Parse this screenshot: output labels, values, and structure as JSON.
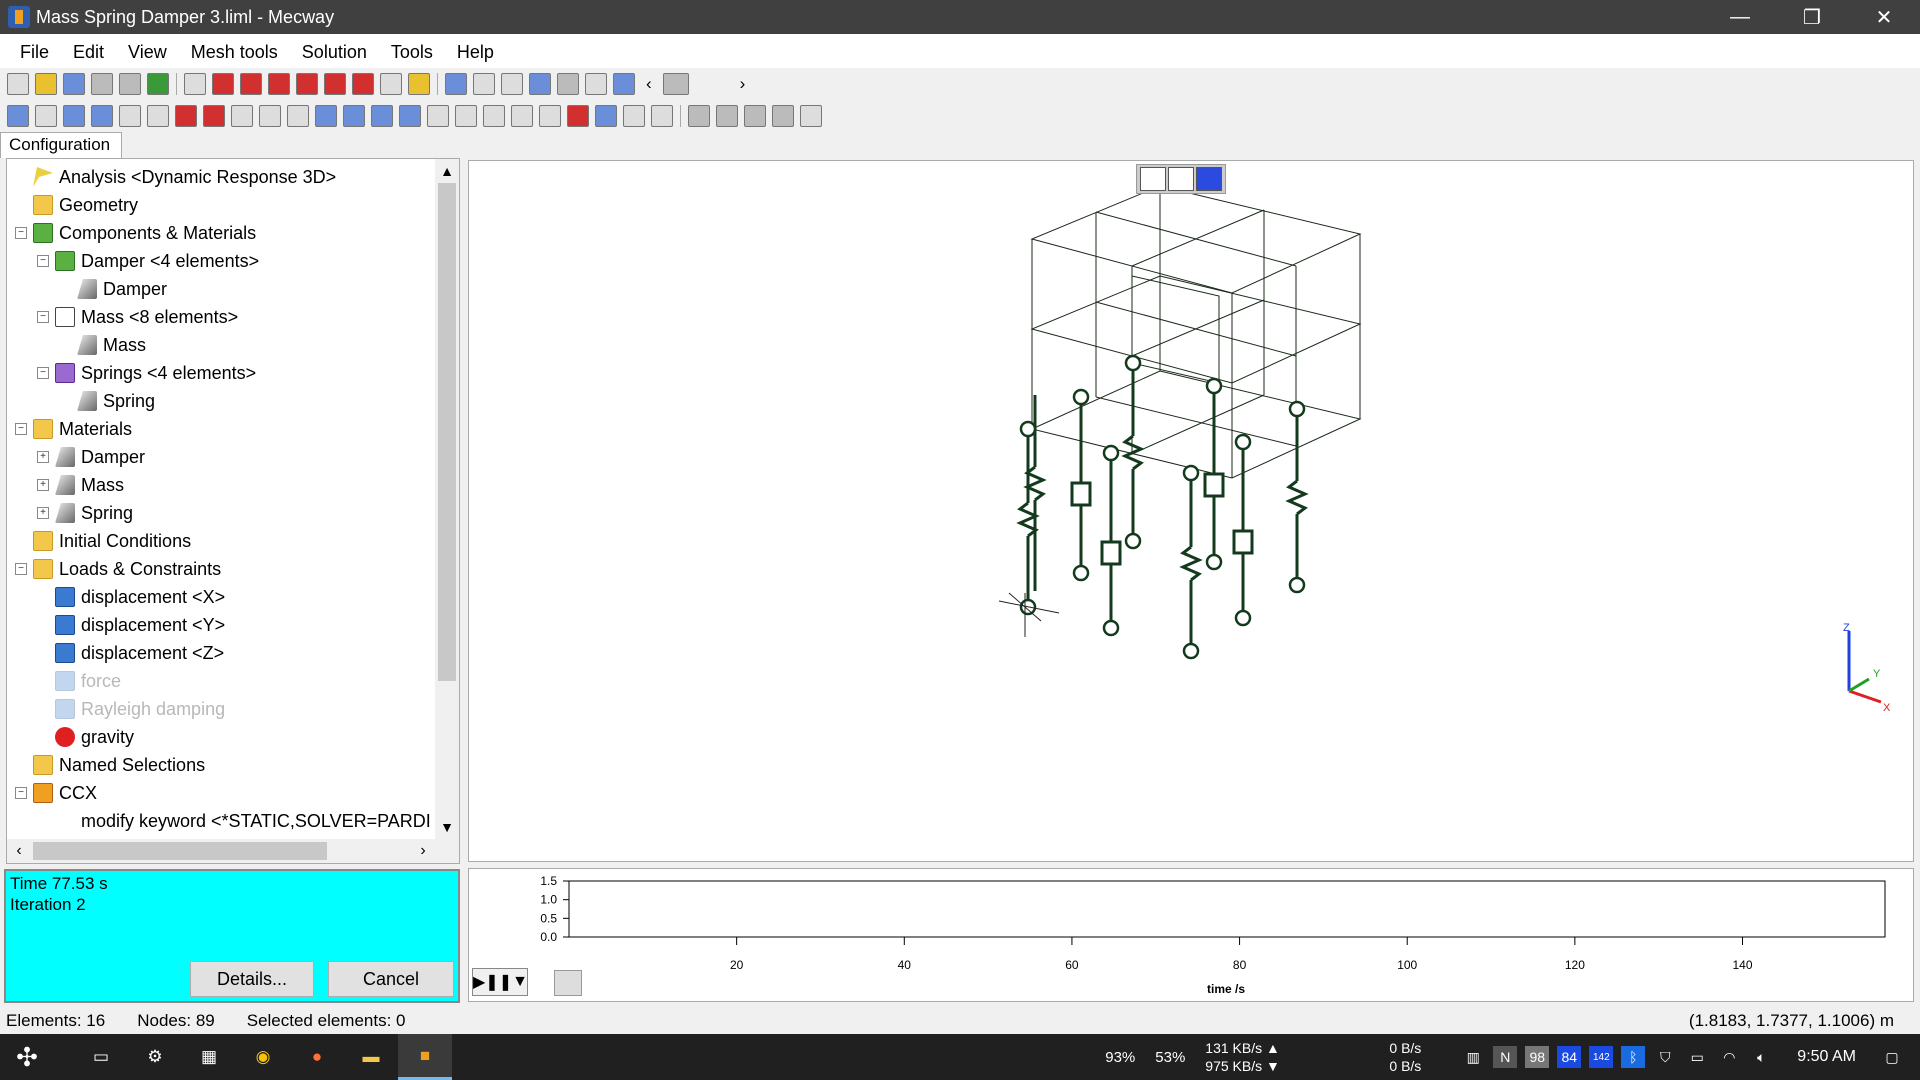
{
  "window": {
    "title": "Mass Spring Damper 3.liml - Mecway",
    "min": "—",
    "max": "❐",
    "close": "✕"
  },
  "menu": [
    "File",
    "Edit",
    "View",
    "Mesh tools",
    "Solution",
    "Tools",
    "Help"
  ],
  "tab": "Configuration",
  "tree": [
    {
      "label": "Analysis <Dynamic Response 3D>",
      "indent": 0,
      "exp": "",
      "icon": "flag"
    },
    {
      "label": "Geometry",
      "indent": 0,
      "exp": "",
      "icon": "folder"
    },
    {
      "label": "Components & Materials",
      "indent": 0,
      "exp": "−",
      "icon": "comp"
    },
    {
      "label": "Damper <4 elements>",
      "indent": 1,
      "exp": "−",
      "icon": "comp"
    },
    {
      "label": "Damper",
      "indent": 2,
      "exp": "",
      "icon": "mat"
    },
    {
      "label": "Mass <8 elements>",
      "indent": 1,
      "exp": "−",
      "icon": "comp-w"
    },
    {
      "label": "Mass",
      "indent": 2,
      "exp": "",
      "icon": "mat"
    },
    {
      "label": "Springs <4 elements>",
      "indent": 1,
      "exp": "−",
      "icon": "comp-p"
    },
    {
      "label": "Spring",
      "indent": 2,
      "exp": "",
      "icon": "mat"
    },
    {
      "label": "Materials",
      "indent": 0,
      "exp": "−",
      "icon": "folder"
    },
    {
      "label": "Damper",
      "indent": 1,
      "exp": "+",
      "icon": "mat"
    },
    {
      "label": "Mass",
      "indent": 1,
      "exp": "+",
      "icon": "mat"
    },
    {
      "label": "Spring",
      "indent": 1,
      "exp": "+",
      "icon": "mat"
    },
    {
      "label": "Initial Conditions",
      "indent": 0,
      "exp": "",
      "icon": "folder"
    },
    {
      "label": "Loads & Constraints",
      "indent": 0,
      "exp": "−",
      "icon": "folder"
    },
    {
      "label": "displacement <X>",
      "indent": 1,
      "exp": "",
      "icon": "load"
    },
    {
      "label": "displacement <Y>",
      "indent": 1,
      "exp": "",
      "icon": "load"
    },
    {
      "label": "displacement <Z>",
      "indent": 1,
      "exp": "",
      "icon": "load"
    },
    {
      "label": "force",
      "indent": 1,
      "exp": "",
      "icon": "load",
      "disabled": true
    },
    {
      "label": "Rayleigh damping",
      "indent": 1,
      "exp": "",
      "icon": "load",
      "disabled": true
    },
    {
      "label": "gravity",
      "indent": 1,
      "exp": "",
      "icon": "red"
    },
    {
      "label": "Named Selections",
      "indent": 0,
      "exp": "",
      "icon": "folder"
    },
    {
      "label": "CCX",
      "indent": 0,
      "exp": "−",
      "icon": "ccx"
    },
    {
      "label": "modify keyword <*STATIC,SOLVER=PARDI",
      "indent": 1,
      "exp": "",
      "icon": "none"
    }
  ],
  "status": {
    "time": "Time 77.53 s",
    "iteration": "Iteration 2",
    "details": "Details...",
    "cancel": "Cancel"
  },
  "plot": {
    "yticks": [
      "1.5",
      "1.0",
      "0.5",
      "0.0"
    ],
    "xticks": [
      "20",
      "40",
      "60",
      "80",
      "100",
      "120",
      "140"
    ],
    "xlabel": "time /s"
  },
  "statusbar": {
    "elements": "Elements: 16",
    "nodes": "Nodes: 89",
    "selected": "Selected elements: 0",
    "coords": "(1.8183, 1.7377, 1.1006) m"
  },
  "axes": {
    "z": "Z",
    "y": "Y",
    "x": "X"
  },
  "taskbar": {
    "cpu": "93%",
    "mem": "53%",
    "net_up": "131 KB/s ▲",
    "net_down": "975 KB/s ▼",
    "disk_read": "0 B/s",
    "disk_write": "0 B/s",
    "badges": [
      "N",
      "98",
      "84",
      "142"
    ],
    "clock": "9:50 AM"
  }
}
